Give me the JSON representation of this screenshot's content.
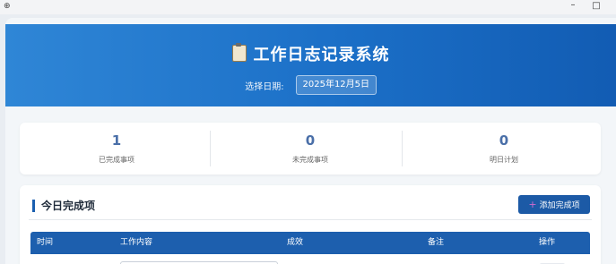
{
  "window": {
    "app_icon": "⊕",
    "min_icon": "–",
    "max_icon": "□"
  },
  "header": {
    "title": "工作日志记录系统",
    "title_icon": "clipboard-icon",
    "date_label": "选择日期:",
    "date_value": "2025年12月5日",
    "gradient_colors": [
      "#2f86d6",
      "#125cb3"
    ]
  },
  "stats": [
    {
      "value": "1",
      "label": "已完成事项"
    },
    {
      "value": "0",
      "label": "未完成事项"
    },
    {
      "value": "0",
      "label": "明日计划"
    }
  ],
  "today": {
    "section_title": "今日完成项",
    "add_button_label": "添加完成项",
    "add_button_icon": "plus-icon",
    "columns": [
      "时间",
      "工作内容",
      "成效",
      "备注",
      "操作"
    ]
  },
  "colors": {
    "primary": "#1c5aa6",
    "stat_number": "#4a6fa8"
  }
}
